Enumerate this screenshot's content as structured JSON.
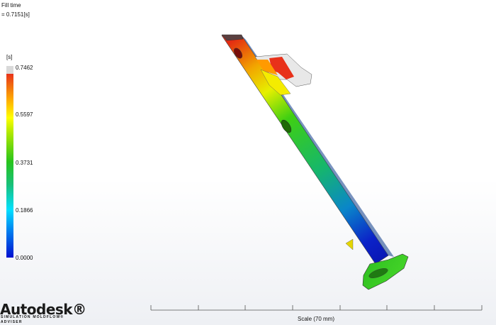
{
  "result": {
    "title": "Fill time",
    "time_value": "= 0.7151[s]"
  },
  "legend": {
    "unit": "[s]",
    "ticks": [
      "0.7462",
      "0.5597",
      "0.3731",
      "0.1866",
      "0.0000"
    ],
    "colors": {
      "max": "#d9d9d9",
      "high": "#e8311a",
      "mid_high": "#ffff00",
      "mid": "#27c41c",
      "mid_low": "#00e0ff",
      "low": "#0010d0"
    }
  },
  "branding": {
    "logo_text": "Autodesk®",
    "product_line1": "SIMULATION MOLDFLOW®",
    "product_line2": "ADVISER"
  },
  "scale": {
    "label": "Scale (70 mm)"
  }
}
